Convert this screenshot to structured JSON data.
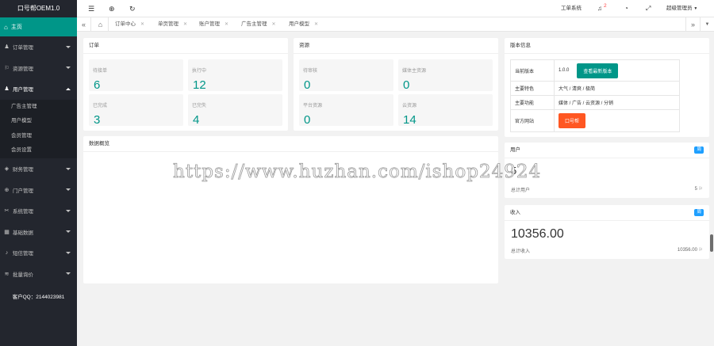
{
  "app": {
    "logo": "口号帮OEM1.0",
    "contact": "客户QQ：2144023981"
  },
  "sidebar": {
    "home": "主页",
    "items": [
      {
        "label": "订单管理",
        "icon": "person-icon"
      },
      {
        "label": "资源管理",
        "icon": "flag-icon"
      },
      {
        "label": "用户管理",
        "icon": "user-icon",
        "open": true
      },
      {
        "label": "财务管理",
        "icon": "finance-icon"
      },
      {
        "label": "门户管理",
        "icon": "globe-icon"
      },
      {
        "label": "系统管理",
        "icon": "wrench-icon"
      },
      {
        "label": "基础数据",
        "icon": "database-icon"
      },
      {
        "label": "短信管理",
        "icon": "bell-icon"
      },
      {
        "label": "批量询价",
        "icon": "wifi-icon"
      }
    ],
    "sub_items": [
      "广告主管理",
      "用户模型",
      "会员管理",
      "会员设置"
    ]
  },
  "topbar": {
    "ticket": "工单系统",
    "notice_count": "2",
    "admin": "超级管理员"
  },
  "tabs": [
    "订单中心",
    "单页管理",
    "账户管理",
    "广告主管理",
    "用户模型"
  ],
  "orders": {
    "title": "订单",
    "stats": [
      {
        "label": "待接单",
        "value": "6"
      },
      {
        "label": "执行中",
        "value": "12"
      },
      {
        "label": "已完成",
        "value": "3"
      },
      {
        "label": "已完失",
        "value": "4"
      }
    ]
  },
  "resources": {
    "title": "资源",
    "stats": [
      {
        "label": "待审核",
        "value": "0"
      },
      {
        "label": "媒体主资源",
        "value": "0"
      },
      {
        "label": "平台资源",
        "value": "0"
      },
      {
        "label": "云资源",
        "value": "14"
      }
    ]
  },
  "overview": {
    "title": "数据概览"
  },
  "version": {
    "title": "版本信息",
    "rows": {
      "current_label": "当前版本",
      "current_value": "1.0.0",
      "check_button": "查看最新版本",
      "feature_label": "主要特色",
      "feature_value": "大气 / 清爽 / 极简",
      "function_label": "主要功能",
      "function_value": "媒体 / 广告 / 云资源 / 分销",
      "site_label": "官方网站",
      "site_button": "口号帮"
    }
  },
  "users": {
    "title": "用户",
    "tag": "周",
    "count": "5",
    "total_label": "总计用户",
    "total_value": "5"
  },
  "income": {
    "title": "收入",
    "tag": "周",
    "amount": "10356.00",
    "total_label": "总计收入",
    "total_value": "10356.00"
  },
  "watermark": "https://www.huzhan.com/ishop24924",
  "colors": {
    "accent": "#009688",
    "sidebar": "#23262e",
    "danger": "#ff5722",
    "tag": "#1e9fff"
  }
}
